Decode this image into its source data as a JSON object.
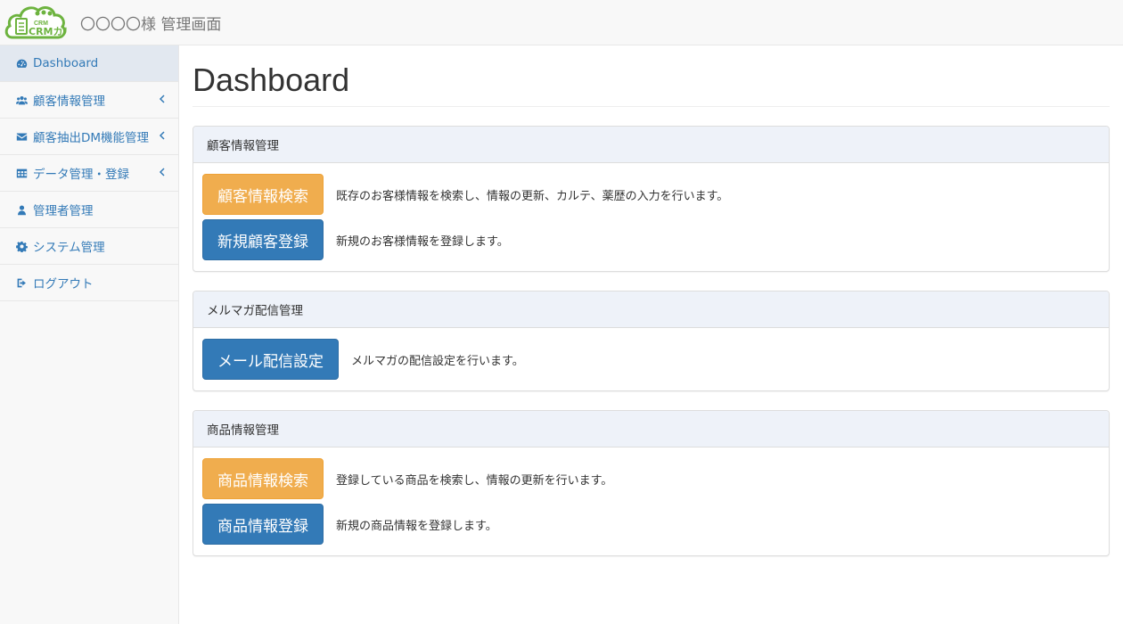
{
  "header": {
    "logo_text": "CRMカルテ",
    "title": "〇〇〇〇様 管理画面"
  },
  "sidebar": {
    "items": [
      {
        "label": "Dashboard",
        "icon": "dashboard-icon",
        "active": true,
        "has_caret": false
      },
      {
        "label": "顧客情報管理",
        "icon": "users-icon",
        "active": false,
        "has_caret": true
      },
      {
        "label": "顧客抽出DM機能管理",
        "icon": "envelope-icon",
        "active": false,
        "has_caret": true
      },
      {
        "label": "データ管理・登録",
        "icon": "table-icon",
        "active": false,
        "has_caret": true
      },
      {
        "label": "管理者管理",
        "icon": "user-icon",
        "active": false,
        "has_caret": false
      },
      {
        "label": "システム管理",
        "icon": "gear-icon",
        "active": false,
        "has_caret": false
      },
      {
        "label": "ログアウト",
        "icon": "sign-out-icon",
        "active": false,
        "has_caret": false
      }
    ]
  },
  "main": {
    "title": "Dashboard",
    "panels": [
      {
        "heading": "顧客情報管理",
        "rows": [
          {
            "button": "顧客情報検索",
            "style": "warning",
            "desc": "既存のお客様情報を検索し、情報の更新、カルテ、薬歴の入力を行います。"
          },
          {
            "button": "新規顧客登録",
            "style": "primary",
            "desc": "新規のお客様情報を登録します。"
          }
        ]
      },
      {
        "heading": "メルマガ配信管理",
        "rows": [
          {
            "button": "メール配信設定",
            "style": "primary",
            "desc": "メルマガの配信設定を行います。"
          }
        ]
      },
      {
        "heading": "商品情報管理",
        "rows": [
          {
            "button": "商品情報検索",
            "style": "warning",
            "desc": "登録している商品を検索し、情報の更新を行います。"
          },
          {
            "button": "商品情報登録",
            "style": "primary",
            "desc": "新規の商品情報を登録します。"
          }
        ]
      }
    ]
  },
  "colors": {
    "link": "#337ab7",
    "warning": "#f0ad4e",
    "primary": "#337ab7",
    "logo_green": "#6db33f"
  }
}
